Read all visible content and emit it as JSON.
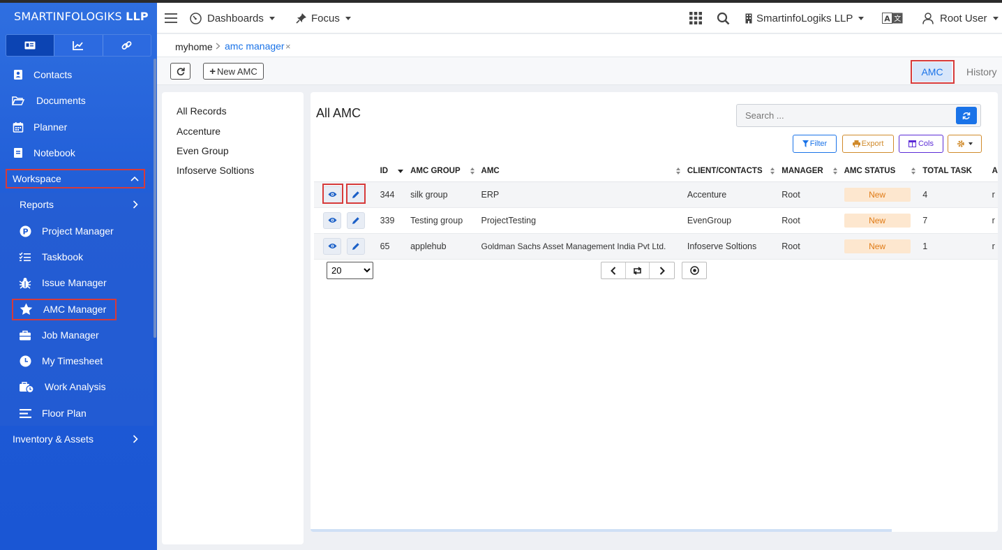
{
  "brand": {
    "name_light": "SMARTINFOLOGIKS",
    "name_bold": "LLP"
  },
  "sidebar": {
    "tabs": [
      {
        "icon": "card-icon",
        "active": true
      },
      {
        "icon": "chart-line-icon",
        "active": false
      },
      {
        "icon": "link-icon",
        "active": false
      }
    ],
    "items": [
      {
        "label": "Contacts",
        "icon": "contact-book-icon"
      },
      {
        "label": "Documents",
        "icon": "folder-open-icon"
      },
      {
        "label": "Planner",
        "icon": "calendar-icon"
      },
      {
        "label": "Notebook",
        "icon": "notebook-icon"
      }
    ],
    "workspace": {
      "label": "Workspace",
      "expanded": true
    },
    "reports": {
      "label": "Reports"
    },
    "sub_items": [
      {
        "label": "Project Manager",
        "icon": "p-circle-icon"
      },
      {
        "label": "Taskbook",
        "icon": "checklist-icon"
      },
      {
        "label": "Issue Manager",
        "icon": "bug-icon"
      },
      {
        "label": "AMC Manager",
        "icon": "star-icon",
        "active": true
      },
      {
        "label": "Job Manager",
        "icon": "briefcase-icon"
      },
      {
        "label": "My Timesheet",
        "icon": "clock-icon"
      },
      {
        "label": "Work Analysis",
        "icon": "briefcase-clock-icon"
      },
      {
        "label": "Floor Plan",
        "icon": "lines-icon"
      }
    ],
    "inventory": {
      "label": "Inventory & Assets"
    }
  },
  "topbar": {
    "dashboards": "Dashboards",
    "focus": "Focus",
    "company": "SmartinfoLogiks LLP",
    "user": "Root User"
  },
  "breadcrumb": {
    "home": "myhome",
    "current": "amc manager",
    "close": "×"
  },
  "toolbar": {
    "new_button": "New AMC",
    "tab_amc": "AMC",
    "tab_history": "History"
  },
  "filters": [
    "All Records",
    "Accenture",
    "Even Group",
    "Infoserve Soltions"
  ],
  "main": {
    "title": "All AMC",
    "search_placeholder": "Search ...",
    "actions": {
      "filter": "Filter",
      "export": "Export",
      "cols": "Cols"
    },
    "columns": {
      "id": "ID",
      "amc_group": "AMC GROUP",
      "amc": "AMC",
      "client": "CLIENT/CONTACTS",
      "manager": "MANAGER",
      "status": "AMC STATUS",
      "total_task": "TOTAL TASK",
      "extra": "A"
    },
    "rows": [
      {
        "id": "344",
        "amc_group": "silk group",
        "amc": "ERP",
        "client": "Accenture",
        "manager": "Root",
        "status": "New",
        "total_task": "4",
        "extra": "r"
      },
      {
        "id": "339",
        "amc_group": "Testing group",
        "amc": "ProjectTesting",
        "client": "EvenGroup",
        "manager": "Root",
        "status": "New",
        "total_task": "7",
        "extra": "r"
      },
      {
        "id": "65",
        "amc_group": "applehub",
        "amc": "Goldman Sachs Asset Management India Pvt Ltd.",
        "client": "Infoserve Soltions",
        "manager": "Root",
        "status": "New",
        "total_task": "1",
        "extra": "r"
      }
    ],
    "page_size": "20",
    "page_size_options": [
      "20"
    ]
  },
  "colors": {
    "sidebar": "#1f5bd6",
    "accent": "#1a73e8",
    "highlight": "#d73a3a",
    "badge_bg": "#fde7cf",
    "badge_text": "#e07b16"
  }
}
